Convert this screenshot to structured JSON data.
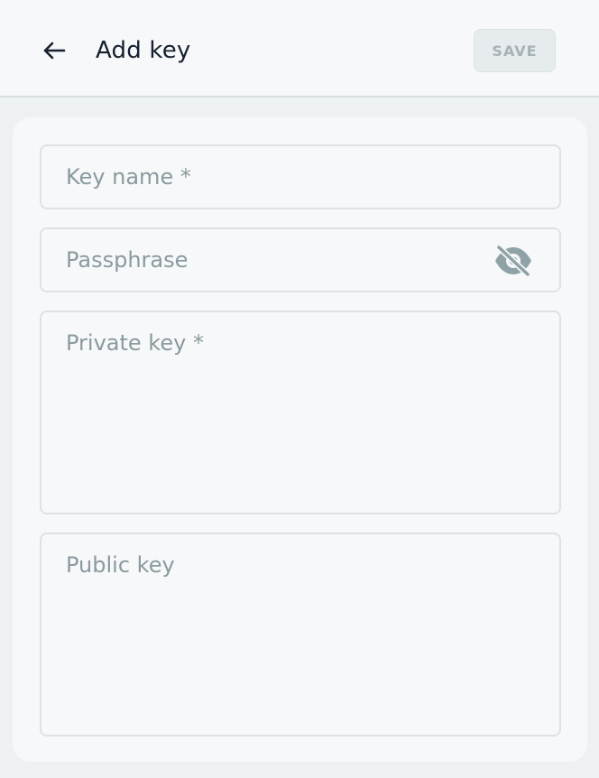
{
  "header": {
    "back_icon": "arrow-left-icon",
    "title": "Add key",
    "save_label": "SAVE"
  },
  "form": {
    "key_name": {
      "placeholder": "Key name *",
      "value": ""
    },
    "passphrase": {
      "placeholder": "Passphrase",
      "value": "",
      "toggle_icon": "eye-off-icon"
    },
    "private_key": {
      "placeholder": "Private key *",
      "value": ""
    },
    "public_key": {
      "placeholder": "Public key",
      "value": ""
    }
  },
  "colors": {
    "background": "#edf1f2",
    "surface": "#f6f8fa",
    "title": "#17202e",
    "placeholder": "#8a9a9e",
    "border": "#dde3e5",
    "save_disabled_bg": "#e6ebed",
    "save_disabled_text": "#a6b2b6",
    "icon": "#8fa2a6"
  }
}
